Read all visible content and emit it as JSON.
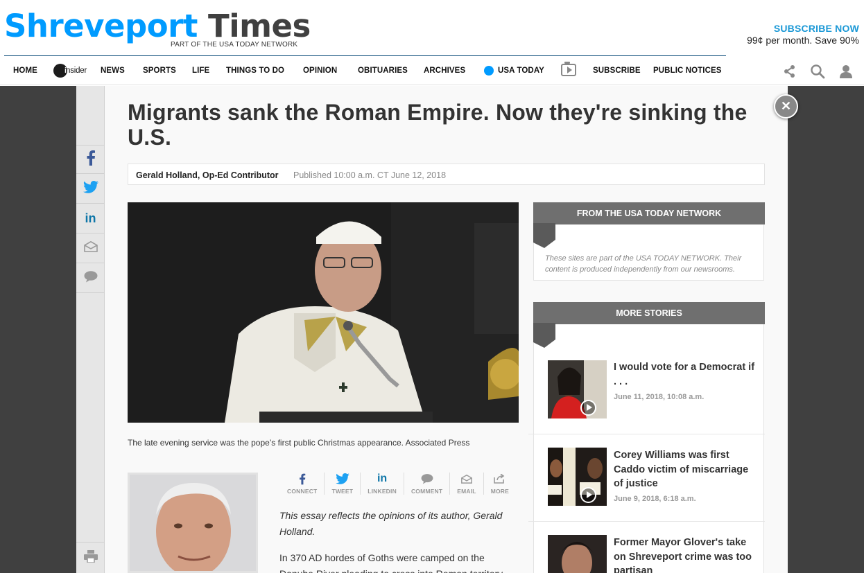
{
  "masthead": {
    "city": "Shreveport",
    "paper": "Times",
    "network_tag": "PART OF THE USA TODAY NETWORK",
    "subscribe_headline": "SUBSCRIBE NOW",
    "subscribe_price": "99¢ per month. Save 90%"
  },
  "nav": {
    "items": [
      {
        "label": "HOME"
      },
      {
        "label": "nsider",
        "badge_letter": "i"
      },
      {
        "label": "NEWS"
      },
      {
        "label": "SPORTS"
      },
      {
        "label": "LIFE"
      },
      {
        "label": "THINGS TO DO"
      },
      {
        "label": "OPINION"
      },
      {
        "label": "OBITUARIES"
      },
      {
        "label": "ARCHIVES"
      },
      {
        "label": "USA TODAY"
      },
      {
        "label": "SUBSCRIBE"
      },
      {
        "label": "PUBLIC NOTICES"
      }
    ],
    "tools": [
      "share-network-icon",
      "search-icon",
      "user-icon"
    ],
    "accent_color": "#009bff"
  },
  "article": {
    "headline": "Migrants sank the Roman Empire. Now they're sinking the U.S.",
    "author": "Gerald Holland, Op-Ed Contributor",
    "published": "Published 10:00 a.m. CT June 12, 2018",
    "caption": "The late evening service was the pope’s first public Christmas appearance. Associated Press",
    "share_buttons": [
      {
        "label": "CONNECT",
        "icon": "facebook-icon"
      },
      {
        "label": "TWEET",
        "icon": "twitter-icon"
      },
      {
        "label": "LINKEDIN",
        "icon": "linkedin-icon"
      },
      {
        "label": "COMMENT",
        "icon": "comment-icon"
      },
      {
        "label": "EMAIL",
        "icon": "email-icon"
      },
      {
        "label": "MORE",
        "icon": "more-share-icon"
      }
    ],
    "disclaimer": "This essay reflects the opinions of its author, Gerald Holland.",
    "body_line_1": "In 370 AD hordes of Goths were camped on the",
    "body_line_2": "Danube River pleading to cross into Roman territory"
  },
  "share_rail": [
    "facebook-icon",
    "twitter-icon",
    "linkedin-icon",
    "email-icon",
    "comment-icon",
    "print-icon"
  ],
  "sidebar": {
    "network_title": "FROM THE USA TODAY NETWORK",
    "network_note": "These sites are part of the USA TODAY NETWORK. Their content is produced independently from our newsrooms.",
    "more_title": "MORE STORIES",
    "stories": [
      {
        "title": "I would vote for a Democrat if . . .",
        "date": "June 11, 2018, 10:08 a.m.",
        "video": true
      },
      {
        "title": "Corey Williams was first Caddo victim of miscarriage of justice",
        "date": "June 9, 2018, 6:18 a.m.",
        "video": true
      },
      {
        "title": "Former Mayor Glover's take on Shreveport crime was too partisan",
        "date": "",
        "video": false
      }
    ]
  }
}
